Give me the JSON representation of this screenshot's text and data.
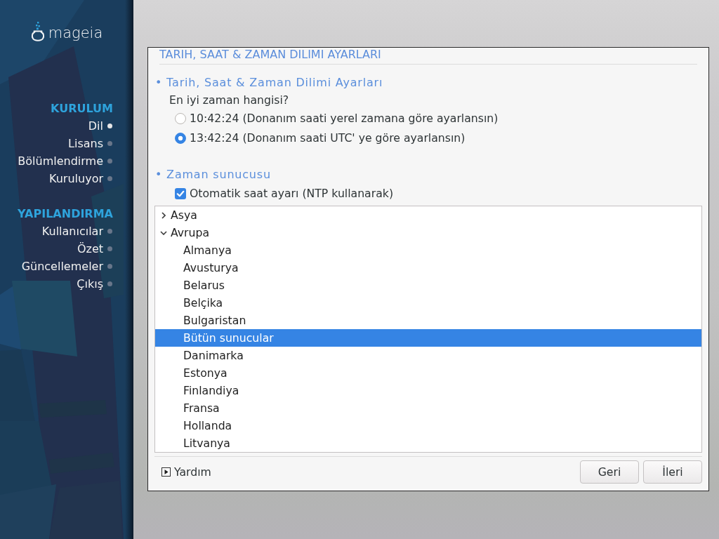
{
  "sidebar": {
    "logo": {
      "text": "mageia"
    },
    "groups": [
      {
        "title": "KURULUM",
        "steps": [
          {
            "label": "Dil",
            "current": true
          },
          {
            "label": "Lisans",
            "current": false
          },
          {
            "label": "Bölümlendirme",
            "current": false
          },
          {
            "label": "Kuruluyor",
            "current": false
          }
        ]
      },
      {
        "title": "YAPILANDIRMA",
        "steps": [
          {
            "label": "Kullanıcılar",
            "current": false
          },
          {
            "label": "Özet",
            "current": false
          },
          {
            "label": "Güncellemeler",
            "current": false
          },
          {
            "label": "Çıkış",
            "current": false
          }
        ]
      }
    ]
  },
  "window": {
    "title": "TARIH, SAAT & ZAMAN DILIMI AYARLARI",
    "clock_section": {
      "heading": "• Tarih, Saat & Zaman Dilimi Ayarları",
      "question": "En iyi zaman hangisi?",
      "options": [
        {
          "label": "10:42:24 (Donanım saati yerel zamana göre ayarlansın)",
          "selected": false
        },
        {
          "label": "13:42:24 (Donanım saati UTC' ye göre ayarlansın)",
          "selected": true
        }
      ]
    },
    "server_section": {
      "heading": "• Zaman sunucusu",
      "ntp_checkbox": {
        "label": "Otomatik saat ayarı (NTP kullanarak)",
        "checked": true
      },
      "server_tree": [
        {
          "label": "Asya",
          "expanded": false,
          "selected": false
        },
        {
          "label": "Avrupa",
          "expanded": true,
          "selected": false,
          "children": [
            {
              "label": "Almanya",
              "selected": false
            },
            {
              "label": "Avusturya",
              "selected": false
            },
            {
              "label": "Belarus",
              "selected": false
            },
            {
              "label": "Belçika",
              "selected": false
            },
            {
              "label": "Bulgaristan",
              "selected": false
            },
            {
              "label": "Bütün sunucular",
              "selected": true
            },
            {
              "label": "Danimarka",
              "selected": false
            },
            {
              "label": "Estonya",
              "selected": false
            },
            {
              "label": "Finlandiya",
              "selected": false
            },
            {
              "label": "Fransa",
              "selected": false
            },
            {
              "label": "Hollanda",
              "selected": false
            },
            {
              "label": "Litvanya",
              "selected": false
            }
          ]
        }
      ]
    },
    "footer": {
      "help": {
        "label": "Yardım"
      },
      "buttons": [
        {
          "label": "Geri"
        },
        {
          "label": "İleri"
        }
      ]
    }
  }
}
